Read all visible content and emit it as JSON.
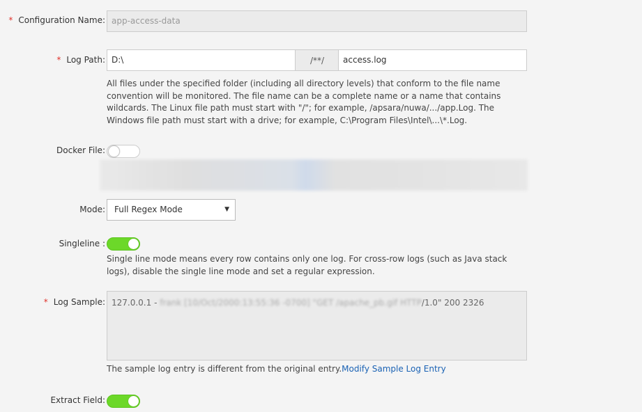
{
  "config_name": {
    "label": "Configuration Name:",
    "value": "app-access-data"
  },
  "log_path": {
    "label": "Log Path:",
    "folder": "D:\\",
    "separator": "/**/",
    "file": "access.log",
    "help": "All files under the specified folder (including all directory levels) that conform to the file name convention will be monitored. The file name can be a complete name or a name that contains wildcards. The Linux file path must start with \"/\"; for example, /apsara/nuwa/.../app.Log. The Windows file path must start with a drive; for example, C:\\Program Files\\Intel\\...\\*.Log."
  },
  "docker_file": {
    "label": "Docker File:",
    "enabled": false
  },
  "mode": {
    "label": "Mode:",
    "selected": "Full Regex Mode"
  },
  "singleline": {
    "label": "Singleline :",
    "enabled": true,
    "help": "Single line mode means every row contains only one log. For cross-row logs (such as Java stack logs), disable the single line mode and set a regular expression."
  },
  "log_sample": {
    "label": "Log Sample:",
    "prefix": "127.0.0.1 -",
    "blurred": "frank [10/Oct/2000:13:55:36 -0700] \"GET /apache_pb.gif HTTP",
    "suffix": "/1.0\" 200 2326",
    "note": "The sample log entry is different from the original entry.",
    "link": "Modify Sample Log Entry"
  },
  "extract_field": {
    "label": "Extract Field:",
    "enabled": true
  },
  "colors": {
    "required": "#e0322b",
    "toggle_on": "#6cd829",
    "link": "#1a62b4"
  }
}
